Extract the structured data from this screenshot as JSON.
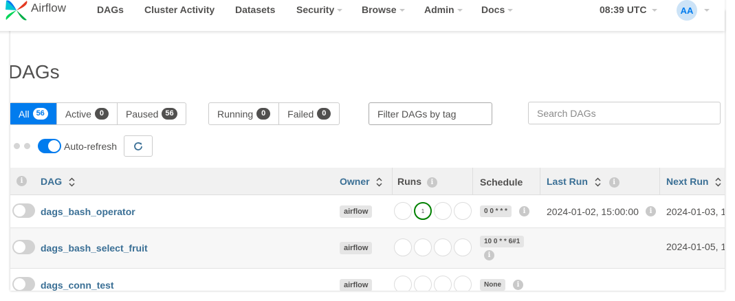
{
  "navbar": {
    "brand": "Airflow",
    "items": [
      {
        "label": "DAGs",
        "dropdown": false
      },
      {
        "label": "Cluster Activity",
        "dropdown": false
      },
      {
        "label": "Datasets",
        "dropdown": false
      },
      {
        "label": "Security",
        "dropdown": true
      },
      {
        "label": "Browse",
        "dropdown": true
      },
      {
        "label": "Admin",
        "dropdown": true
      },
      {
        "label": "Docs",
        "dropdown": true
      }
    ],
    "time": "08:39 UTC",
    "avatar": "AA"
  },
  "page_title": "DAGs",
  "status_filters": [
    {
      "label": "All",
      "count": "56",
      "active": true
    },
    {
      "label": "Active",
      "count": "0",
      "active": false
    },
    {
      "label": "Paused",
      "count": "56",
      "active": false
    }
  ],
  "run_filters": [
    {
      "label": "Running",
      "count": "0"
    },
    {
      "label": "Failed",
      "count": "0"
    }
  ],
  "tag_filter": {
    "placeholder": "Filter DAGs by tag"
  },
  "search": {
    "placeholder": "Search DAGs"
  },
  "auto_refresh": {
    "label": "Auto-refresh",
    "enabled": true
  },
  "table": {
    "headers": {
      "dag": "DAG",
      "owner": "Owner",
      "runs": "Runs",
      "schedule": "Schedule",
      "last_run": "Last Run",
      "next_run": "Next Run"
    },
    "rows": [
      {
        "dag_id": "dags_bash_operator",
        "owner": "airflow",
        "runs_center_label": "1",
        "schedule": "0 0 * * *",
        "last_run": "2024-01-02, 15:00:00",
        "next_run": "2024-01-03, 1"
      },
      {
        "dag_id": "dags_bash_select_fruit",
        "owner": "airflow",
        "runs_center_label": "",
        "schedule": "10 0 * * 6#1",
        "last_run": "",
        "next_run": "2024-01-05, 1"
      },
      {
        "dag_id": "dags_conn_test",
        "owner": "airflow",
        "runs_center_label": "",
        "schedule": "None",
        "last_run": "",
        "next_run": ""
      }
    ]
  },
  "colors": {
    "accent": "#017cee",
    "success": "#008000",
    "link": "#3a6f95"
  }
}
